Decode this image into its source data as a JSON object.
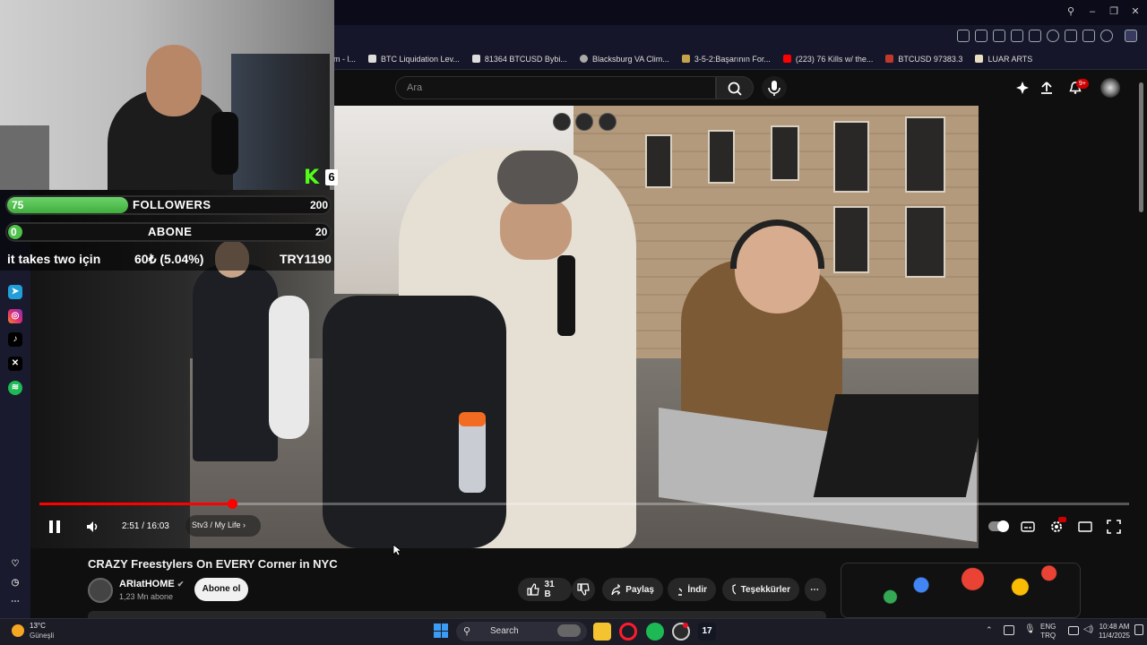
{
  "bookmarks": [
    {
      "label": "m - l...",
      "color": "#777"
    },
    {
      "label": "BTC Liquidation Lev...",
      "color": "#444"
    },
    {
      "label": "81364 BTCUSD Bybi...",
      "color": "#444"
    },
    {
      "label": "Blacksburg VA Clim...",
      "color": "#888"
    },
    {
      "label": "3-5-2:Başarının For...",
      "color": "#c5a34a"
    },
    {
      "label": "(223) 76 Kills w/ the...",
      "color": "#ff0000"
    },
    {
      "label": "BTCUSD 97383.3",
      "color": "#c0392b"
    },
    {
      "label": "LUAR ARTS",
      "color": "#e8e0c0"
    }
  ],
  "search": {
    "placeholder": "Ara"
  },
  "notifications": {
    "badge": "9+"
  },
  "stream_overlay": {
    "followers": {
      "current": "75",
      "goal": "200",
      "label": "FOLLOWERS",
      "fill": 0.375
    },
    "abone": {
      "current": "0",
      "goal": "20",
      "label": "ABONE",
      "fill": 0.0
    },
    "donation_text": "it takes two için",
    "donation_amount": "60₺ (5.04%)",
    "donation_goal": "TRY1190",
    "kick_count": "6"
  },
  "player": {
    "time": "2:51 / 16:03",
    "chapter": "Stv3 / My Life",
    "progress": 0.177,
    "accent": "#ff0000"
  },
  "video": {
    "title": "CRAZY Freestylers On EVERY Corner in NYC",
    "channel": "ARIatHOME",
    "subscribers": "1,23 Mn abone",
    "subscribe_label": "Abone ol",
    "likes": "31 B",
    "share_label": "Paylaş",
    "download_label": "İndir",
    "thanks_label": "Teşekkürler"
  },
  "taskbar": {
    "weather_temp": "13°C",
    "weather_desc": "Güneşli",
    "search_label": "Search",
    "lang_top": "ENG",
    "lang_bottom": "TRQ",
    "time": "10:48 AM",
    "date": "11/4/2025"
  }
}
